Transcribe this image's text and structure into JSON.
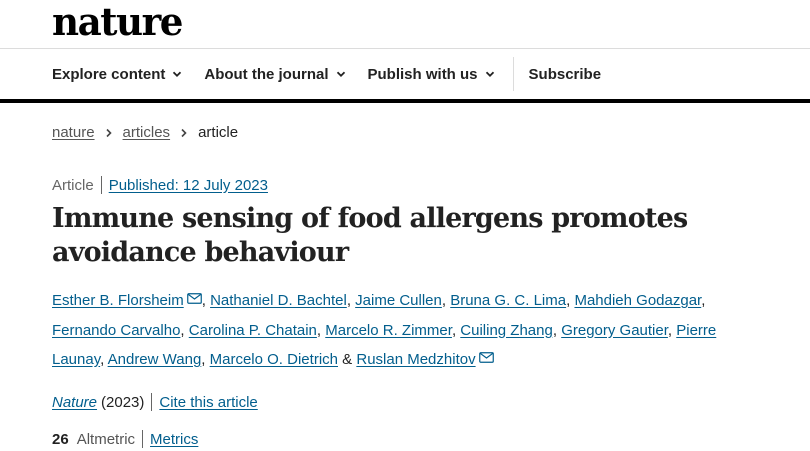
{
  "header": {
    "logo": "nature",
    "nav": [
      {
        "label": "Explore content"
      },
      {
        "label": "About the journal"
      },
      {
        "label": "Publish with us"
      }
    ],
    "subscribe_label": "Subscribe"
  },
  "breadcrumb": {
    "items": [
      "nature",
      "articles"
    ],
    "current": "article"
  },
  "article": {
    "type": "Article",
    "published": "Published: 12 July 2023",
    "title": "Immune sensing of food allergens promotes avoidance behaviour",
    "authors": [
      {
        "name": "Esther B. Florsheim",
        "email": true
      },
      {
        "name": "Nathaniel D. Bachtel"
      },
      {
        "name": "Jaime Cullen"
      },
      {
        "name": "Bruna G. C. Lima"
      },
      {
        "name": "Mahdieh Godazgar"
      },
      {
        "name": "Fernando Carvalho"
      },
      {
        "name": "Carolina P. Chatain"
      },
      {
        "name": "Marcelo R. Zimmer"
      },
      {
        "name": "Cuiling Zhang"
      },
      {
        "name": "Gregory Gautier"
      },
      {
        "name": "Pierre Launay"
      },
      {
        "name": "Andrew Wang"
      },
      {
        "name": "Marcelo O. Dietrich"
      },
      {
        "name": "Ruslan Medzhitov",
        "email": true
      }
    ],
    "last_author_joiner": "&",
    "journal": "Nature",
    "year": "(2023)",
    "cite_label": "Cite this article",
    "altmetric_count": "26",
    "altmetric_label": "Altmetric",
    "metrics_label": "Metrics"
  },
  "colors": {
    "link": "#025e8d",
    "text": "#222222",
    "rule": "#000000"
  }
}
